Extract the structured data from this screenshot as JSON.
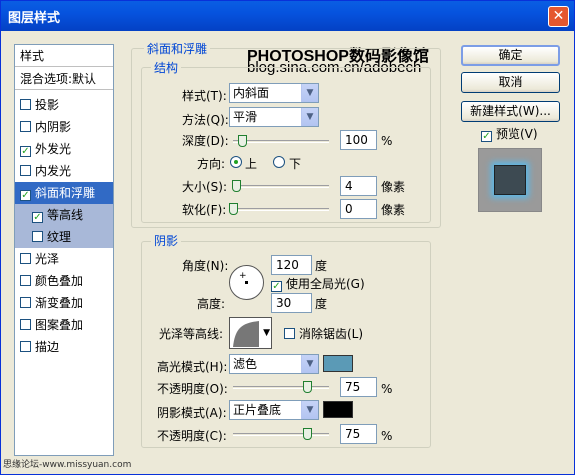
{
  "window": {
    "title": "图层样式"
  },
  "left_panel": {
    "header": "样式",
    "blend": "混合选项:默认",
    "items": [
      {
        "label": "投影",
        "checked": false
      },
      {
        "label": "内阴影",
        "checked": false
      },
      {
        "label": "外发光",
        "checked": true
      },
      {
        "label": "内发光",
        "checked": false
      },
      {
        "label": "斜面和浮雕",
        "checked": true
      },
      {
        "label": "等高线",
        "checked": true
      },
      {
        "label": "纹理",
        "checked": false
      },
      {
        "label": "光泽",
        "checked": false
      },
      {
        "label": "颜色叠加",
        "checked": false
      },
      {
        "label": "渐变叠加",
        "checked": false
      },
      {
        "label": "图案叠加",
        "checked": false
      },
      {
        "label": "描边",
        "checked": false
      }
    ]
  },
  "buttons": {
    "ok": "确定",
    "cancel": "取消",
    "new_style": "新建样式(W)...",
    "preview": "预览(V)"
  },
  "watermark": {
    "line1": "PHOTOSHOP数码影像馆",
    "line2": "blog.sina.com.cn/adobech"
  },
  "bevel": {
    "group_title": "斜面和浮雕",
    "structure_title": "结构",
    "style_label": "样式(T):",
    "style_value": "内斜面",
    "technique_label": "方法(Q):",
    "technique_value": "平滑",
    "depth_label": "深度(D):",
    "depth_value": "100",
    "depth_unit": "%",
    "direction_label": "方向:",
    "dir_up": "上",
    "dir_down": "下",
    "size_label": "大小(S):",
    "size_value": "4",
    "size_unit": "像素",
    "soften_label": "软化(F):",
    "soften_value": "0",
    "soften_unit": "像素"
  },
  "shading": {
    "title": "阴影",
    "angle_label": "角度(N):",
    "angle_value": "120",
    "angle_unit": "度",
    "global_light": "使用全局光(G)",
    "altitude_label": "高度:",
    "altitude_value": "30",
    "altitude_unit": "度",
    "gloss_label": "光泽等高线:",
    "anti_alias": "消除锯齿(L)",
    "highlight_label": "高光模式(H):",
    "highlight_mode": "滤色",
    "highlight_color": "#5b9ab6",
    "highlight_opacity_label": "不透明度(O):",
    "highlight_opacity": "75",
    "highlight_opacity_unit": "%",
    "shadow_label": "阴影模式(A):",
    "shadow_mode": "正片叠底",
    "shadow_color": "#000000",
    "shadow_opacity_label": "不透明度(C):",
    "shadow_opacity": "75",
    "shadow_opacity_unit": "%"
  },
  "footer": "思缘论坛-www.missyuan.com"
}
